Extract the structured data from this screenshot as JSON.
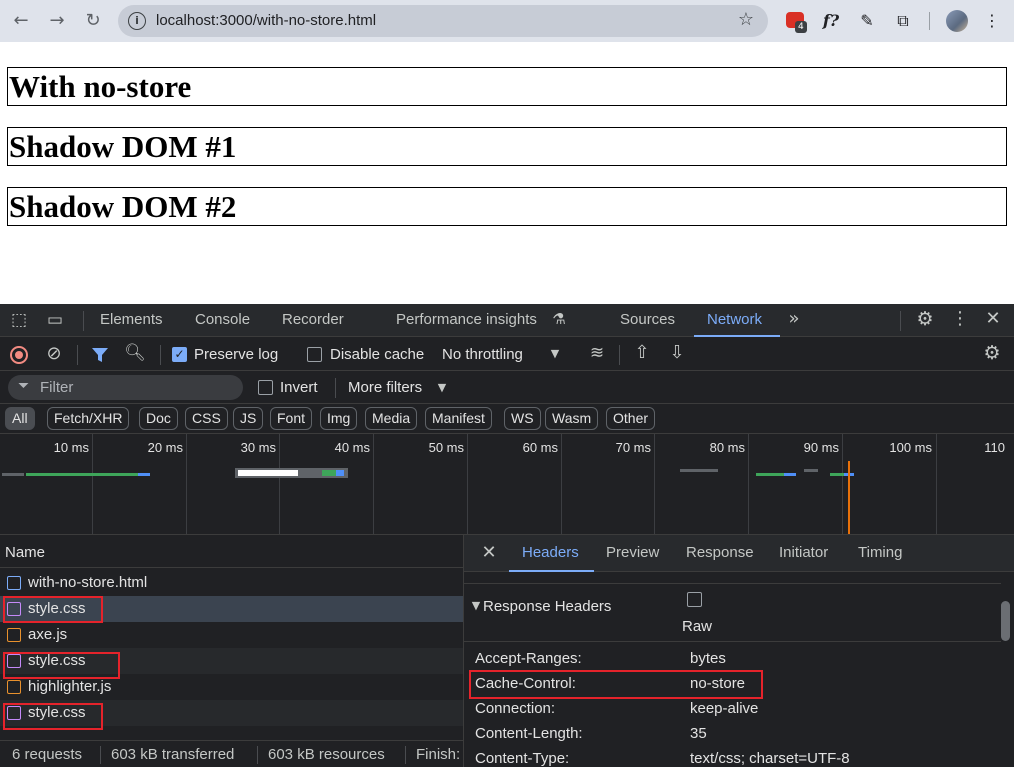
{
  "browser": {
    "url": "localhost:3000/with-no-store.html",
    "ext_badge": "4"
  },
  "page": {
    "headings": [
      "With no-store",
      "Shadow DOM #1",
      "Shadow DOM #2"
    ]
  },
  "devtools": {
    "tabs": [
      "Elements",
      "Console",
      "Recorder",
      "Performance insights",
      "Sources",
      "Network"
    ],
    "active_tab": "Network",
    "toolbar": {
      "preserve_log": "Preserve log",
      "preserve_log_checked": true,
      "disable_cache": "Disable cache",
      "disable_cache_checked": false,
      "throttling": "No throttling"
    },
    "filter": {
      "placeholder": "Filter",
      "invert": "Invert",
      "more_filters": "More filters"
    },
    "type_filters": [
      "All",
      "Fetch/XHR",
      "Doc",
      "CSS",
      "JS",
      "Font",
      "Img",
      "Media",
      "Manifest",
      "WS",
      "Wasm",
      "Other"
    ],
    "timeline_ticks": [
      "10 ms",
      "20 ms",
      "30 ms",
      "40 ms",
      "50 ms",
      "60 ms",
      "70 ms",
      "80 ms",
      "90 ms",
      "100 ms",
      "110"
    ],
    "requests": {
      "header": "Name",
      "rows": [
        {
          "name": "with-no-store.html",
          "type": "doc",
          "highlighted": false
        },
        {
          "name": "style.css",
          "type": "css",
          "highlighted": true
        },
        {
          "name": "axe.js",
          "type": "js",
          "highlighted": false
        },
        {
          "name": "style.css",
          "type": "css",
          "highlighted": true
        },
        {
          "name": "highlighter.js",
          "type": "js",
          "highlighted": false
        },
        {
          "name": "style.css",
          "type": "css",
          "highlighted": true
        }
      ]
    },
    "status_bar": {
      "requests": "6 requests",
      "transferred": "603 kB transferred",
      "resources": "603 kB resources",
      "finish": "Finish:"
    },
    "details": {
      "tabs": [
        "Headers",
        "Preview",
        "Response",
        "Initiator",
        "Timing"
      ],
      "active_tab": "Headers",
      "section": "Response Headers",
      "raw_label": "Raw",
      "headers": [
        {
          "name": "Accept-Ranges:",
          "value": "bytes"
        },
        {
          "name": "Cache-Control:",
          "value": "no-store"
        },
        {
          "name": "Connection:",
          "value": "keep-alive"
        },
        {
          "name": "Content-Length:",
          "value": "35"
        },
        {
          "name": "Content-Type:",
          "value": "text/css; charset=UTF-8"
        }
      ]
    }
  },
  "colors": {
    "accent": "#7cacf8",
    "highlight_box": "#e5232b"
  }
}
